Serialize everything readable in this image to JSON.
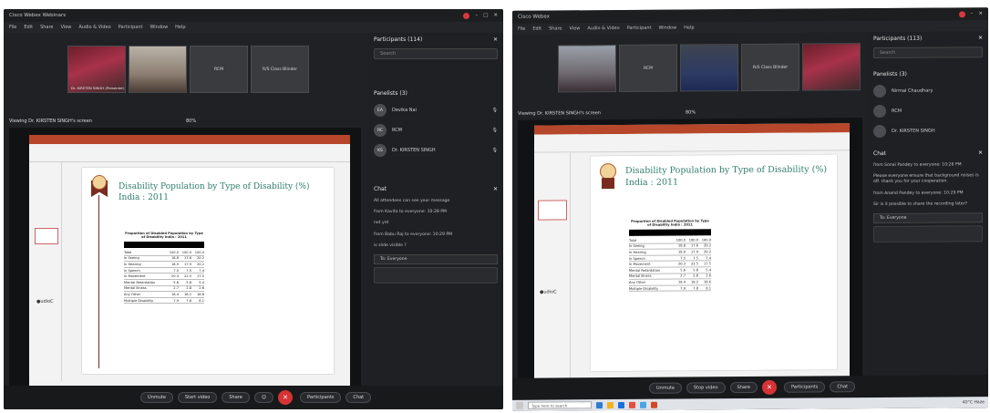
{
  "left": {
    "title_tab": "Cisco Webex Webinars",
    "menu": [
      "File",
      "Edit",
      "Share",
      "View",
      "Audio & Video",
      "Participant",
      "Window",
      "Help"
    ],
    "thumbs": [
      {
        "name": "Dr. KIRSTEN SINGH (Presenter)"
      },
      {
        "name": ""
      },
      {
        "name": "RCM"
      },
      {
        "name": "R/S Class Blinder"
      }
    ],
    "viewing": "Viewing Dr. KIRSTEN SINGH's screen",
    "zoom": "80%",
    "slide_title": "Disability Population by Type of Disability (%)",
    "slide_subtitle": "India : 2011",
    "table_title": "Proportion of Disabled Population by Type of Disability India : 2011",
    "table_rows": [
      [
        "Total",
        "100.0",
        "100.0",
        "100.0"
      ],
      [
        "In Seeing",
        "18.8",
        "17.6",
        "20.2"
      ],
      [
        "In Hearing",
        "18.9",
        "17.9",
        "20.2"
      ],
      [
        "In Speech",
        "7.5",
        "7.5",
        "7.4"
      ],
      [
        "In Movement",
        "20.3",
        "22.5",
        "17.5"
      ],
      [
        "Mental Retardation",
        "5.6",
        "5.8",
        "5.4"
      ],
      [
        "Mental Illness",
        "2.7",
        "2.8",
        "2.6"
      ],
      [
        "Any Other",
        "18.4",
        "18.2",
        "18.6"
      ],
      [
        "Multiple Disability",
        "7.9",
        "7.8",
        "8.1"
      ]
    ],
    "participants_title": "Participants (114)",
    "search_placeholder": "Search",
    "panelists_title": "Panelists (3)",
    "panelists": [
      {
        "initials": "EA",
        "name": "Devika Nai"
      },
      {
        "initials": "RC",
        "name": "RCM"
      },
      {
        "initials": "KS",
        "name": "Dr. KIRSTEN SINGH"
      }
    ],
    "chat_title": "Chat",
    "chat_messages": [
      "All attendees can see your message",
      "from Kavita to everyone: 10:28 PM",
      "not yet",
      "from Babu Raj to everyone: 10:29 PM",
      "is slide visible ?"
    ],
    "to_label": "To:",
    "to_value": "Everyone",
    "toolbar": {
      "unmute": "Unmute",
      "start_video": "Start video",
      "share": "Share",
      "participants": "Participants",
      "chat": "Chat"
    }
  },
  "right": {
    "title_tab": "Cisco Webex",
    "menu": [
      "File",
      "Edit",
      "Share",
      "View",
      "Audio & Video",
      "Participant",
      "Window",
      "Help"
    ],
    "thumbs": [
      {
        "name": ""
      },
      {
        "name": "RCM"
      },
      {
        "name": "R/S Class Blinder"
      },
      {
        "name": ""
      },
      {
        "name": ""
      }
    ],
    "layout": "Layout",
    "viewing": "Viewing Dr. KIRSTEN SINGH's screen",
    "zoom": "80%",
    "slide_title": "Disability Population by Type of Disability (%)",
    "slide_subtitle": "India : 2011",
    "table_title": "Proportion of Disabled Population by Type of Disability India : 2011",
    "table_rows": [
      [
        "Total",
        "100.0",
        "100.0",
        "100.0"
      ],
      [
        "In Seeing",
        "18.8",
        "17.6",
        "20.2"
      ],
      [
        "In Hearing",
        "18.9",
        "17.9",
        "20.2"
      ],
      [
        "In Speech",
        "7.5",
        "7.5",
        "7.4"
      ],
      [
        "In Movement",
        "20.3",
        "22.5",
        "17.5"
      ],
      [
        "Mental Retardation",
        "5.6",
        "5.8",
        "5.4"
      ],
      [
        "Mental Illness",
        "2.7",
        "2.8",
        "2.6"
      ],
      [
        "Any Other",
        "18.4",
        "18.2",
        "18.6"
      ],
      [
        "Multiple Disability",
        "7.9",
        "7.8",
        "8.1"
      ]
    ],
    "participants_title": "Participants (113)",
    "search_placeholder": "Search",
    "panelists_title": "Panelists (3)",
    "panelists": [
      {
        "initials": "",
        "name": "Nirmal Chaudhary"
      },
      {
        "initials": "",
        "name": "RCM"
      },
      {
        "initials": "",
        "name": "Dr. KIRSTEN SINGH"
      }
    ],
    "chat_title": "Chat",
    "chat_messages": [
      "from Sonal Pandey to everyone: 10:28 PM",
      "Please everyone ensure that background noises is off. thank you for your cooperation.",
      "from Anand Pandey to everyone: 10:29 PM",
      "Sir is it possible to share the recording later?"
    ],
    "to_label": "To:",
    "to_value": "Everyone",
    "toolbar": {
      "unmute": "Unmute",
      "stop_video": "Stop video",
      "share": "Share",
      "participants": "Participants",
      "chat": "Chat"
    },
    "taskbar": {
      "search": "Type here to search",
      "weather": "40°C Haze"
    }
  },
  "colors": {
    "accent_red": "#d53335",
    "slide_teal": "#2e7d6b",
    "donut": [
      "#2a7ac1",
      "#4fb0e6",
      "#2e9c58",
      "#8ccd5e",
      "#f0c419",
      "#e46c2c",
      "#9b59b6",
      "#c0c0c0",
      "#6fd0c8"
    ]
  }
}
